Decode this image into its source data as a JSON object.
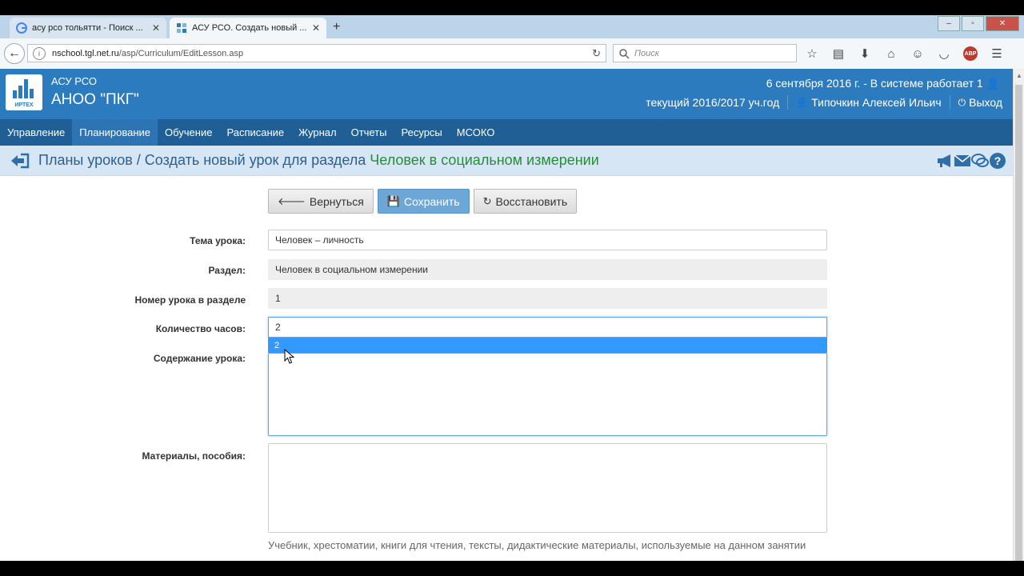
{
  "browser": {
    "tabs": [
      {
        "title": "асу рсо тольятти - Поиск ...",
        "active": false
      },
      {
        "title": "АСУ РСО. Создать новый ...",
        "active": true
      }
    ],
    "url_host": "nschool.tgl.net.ru",
    "url_path": "/asp/Curriculum/EditLesson.asp",
    "search_placeholder": "Поиск"
  },
  "header": {
    "logo_text": "ИРТЕХ",
    "app_name": "АСУ РСО",
    "org_name": "АНОО \"ПКГ\"",
    "date_status": "6 сентября 2016 г. - В системе работает 1",
    "school_year": "текущий 2016/2017 уч.год",
    "user_name": "Типочкин Алексей Ильич",
    "logout": "Выход"
  },
  "menu": {
    "items": [
      "Управление",
      "Планирование",
      "Обучение",
      "Расписание",
      "Журнал",
      "Отчеты",
      "Ресурсы",
      "МСОКО"
    ],
    "active_index": 1
  },
  "title": {
    "prefix": "Планы уроков / Создать новый урок для раздела",
    "section": "Человек в социальном измерении"
  },
  "buttons": {
    "back": "Вернуться",
    "save": "Сохранить",
    "restore": "Восстановить"
  },
  "form": {
    "topic_label": "Тема урока:",
    "topic_value": "Человек – личность",
    "section_label": "Раздел:",
    "section_value": "Человек в социальном измерении",
    "number_label": "Номер урока в разделе",
    "number_value": "1",
    "hours_label": "Количество часов:",
    "hours_value": "2",
    "hours_suggestion": "2",
    "content_label": "Содержание урока:",
    "materials_label": "Материалы, пособия:",
    "materials_hint": "Учебник, хрестоматии, книги для чтения, тексты, дидактические материалы, используемые на данном занятии"
  },
  "colors": {
    "header_blue": "#2d7bbf",
    "menu_blue": "#1f5f96",
    "section_green": "#2b8a3e"
  }
}
